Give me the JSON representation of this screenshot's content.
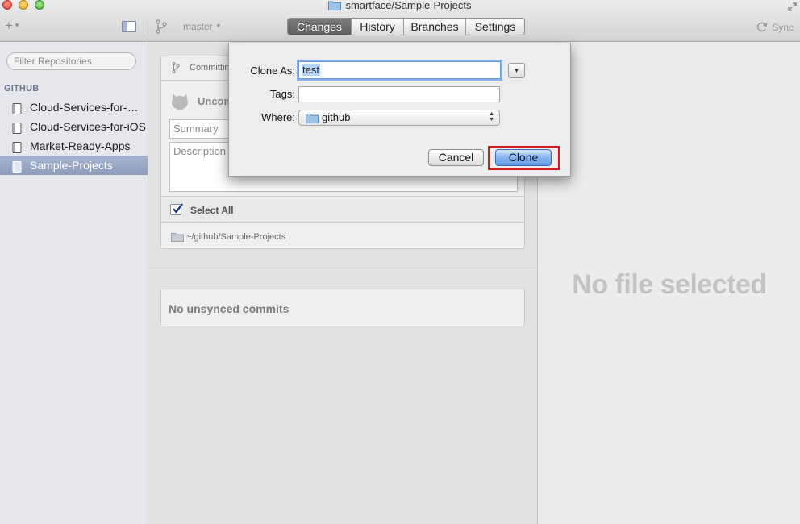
{
  "window": {
    "title": "smartface/Sample-Projects"
  },
  "toolbar": {
    "branch": "master",
    "tabs": [
      {
        "label": "Changes",
        "active": true
      },
      {
        "label": "History",
        "active": false
      },
      {
        "label": "Branches",
        "active": false
      },
      {
        "label": "Settings",
        "active": false
      }
    ],
    "sync_label": "Sync"
  },
  "sidebar": {
    "filter_placeholder": "Filter Repositories",
    "section": "GITHUB",
    "repos": [
      {
        "label": "Cloud-Services-for-…",
        "selected": false
      },
      {
        "label": "Cloud-Services-for-iOS",
        "selected": false
      },
      {
        "label": "Market-Ready-Apps",
        "selected": false
      },
      {
        "label": "Sample-Projects",
        "selected": true
      }
    ]
  },
  "commit": {
    "committing_label": "Committin",
    "uncommitted_label": "Uncom",
    "summary_placeholder": "Summary",
    "description_placeholder": "Description",
    "select_all": "Select All",
    "select_all_checked": true,
    "path": "~/github/Sample-Projects"
  },
  "unsynced": {
    "label": "No unsynced commits"
  },
  "right_panel": {
    "empty_label": "No file selected"
  },
  "clone_dialog": {
    "clone_as_label": "Clone As:",
    "clone_as_value": "test",
    "tags_label": "Tags:",
    "tags_value": "",
    "where_label": "Where:",
    "where_value": "github",
    "cancel_label": "Cancel",
    "clone_label": "Clone"
  },
  "colors": {
    "selection": "#8d9dbb",
    "highlight_frame": "#d6181e",
    "default_button": "#7fb0f0"
  }
}
